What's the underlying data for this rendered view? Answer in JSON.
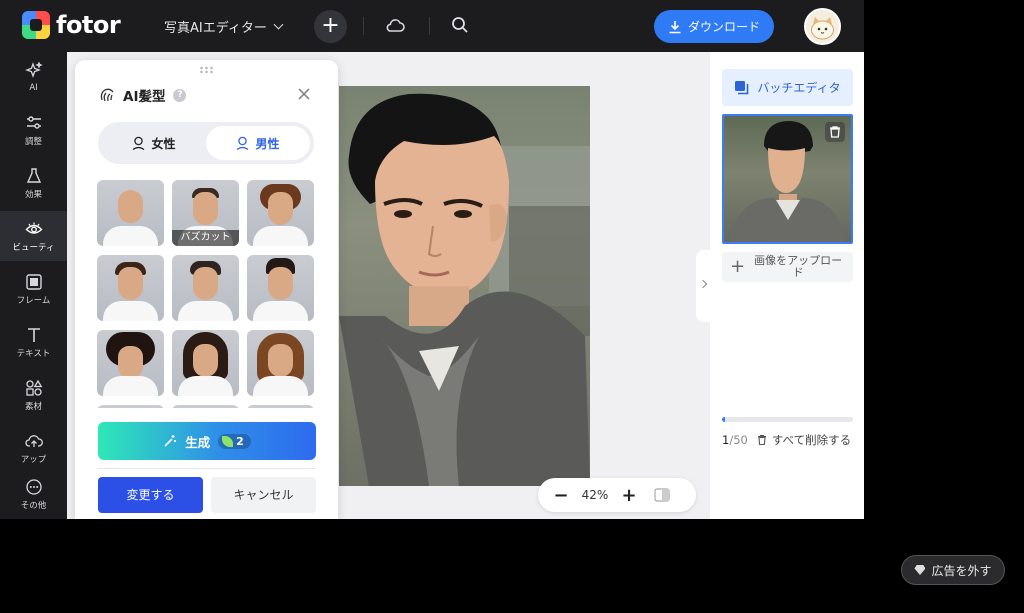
{
  "app": {
    "logo": "fotor"
  },
  "header": {
    "doc_title": "写真AIエディター",
    "add_label": "+",
    "download_label": "ダウンロード"
  },
  "rail": {
    "items": [
      {
        "label": "AI",
        "icon": "sparkle-icon"
      },
      {
        "label": "調整",
        "icon": "sliders-icon"
      },
      {
        "label": "効果",
        "icon": "flask-icon"
      },
      {
        "label": "ビューティ",
        "icon": "eye-icon",
        "active": true
      },
      {
        "label": "フレーム",
        "icon": "frame-icon"
      },
      {
        "label": "テキスト",
        "icon": "text-icon"
      },
      {
        "label": "素材",
        "icon": "shapes-icon"
      },
      {
        "label": "アップ",
        "icon": "upload-cloud-icon"
      },
      {
        "label": "その他",
        "icon": "more-icon"
      }
    ]
  },
  "panel": {
    "title": "AI髪型",
    "gender": {
      "female": "女性",
      "male": "男性",
      "selected": "male"
    },
    "styles": [
      {
        "label": ""
      },
      {
        "label": "バズカット"
      },
      {
        "label": ""
      },
      {
        "label": ""
      },
      {
        "label": ""
      },
      {
        "label": ""
      },
      {
        "label": ""
      },
      {
        "label": ""
      },
      {
        "label": ""
      }
    ],
    "generate_label": "生成",
    "credits": "2",
    "apply_label": "変更する",
    "cancel_label": "キャンセル"
  },
  "canvas": {
    "zoom": "42%",
    "zoom_minus": "−",
    "zoom_plus": "+"
  },
  "right_panel": {
    "batch_label": "バッチエディタ",
    "upload_label": "画像をアップロード",
    "count": "1",
    "count_total": "/50",
    "progress_fraction": 0.02,
    "delete_all_label": "すべて削除する"
  },
  "ad": {
    "remove_ads_label": "広告を外す"
  },
  "colors": {
    "accent": "#2f7bf6",
    "apply": "#2c50e6",
    "dark_bg": "#1c1c1f"
  }
}
